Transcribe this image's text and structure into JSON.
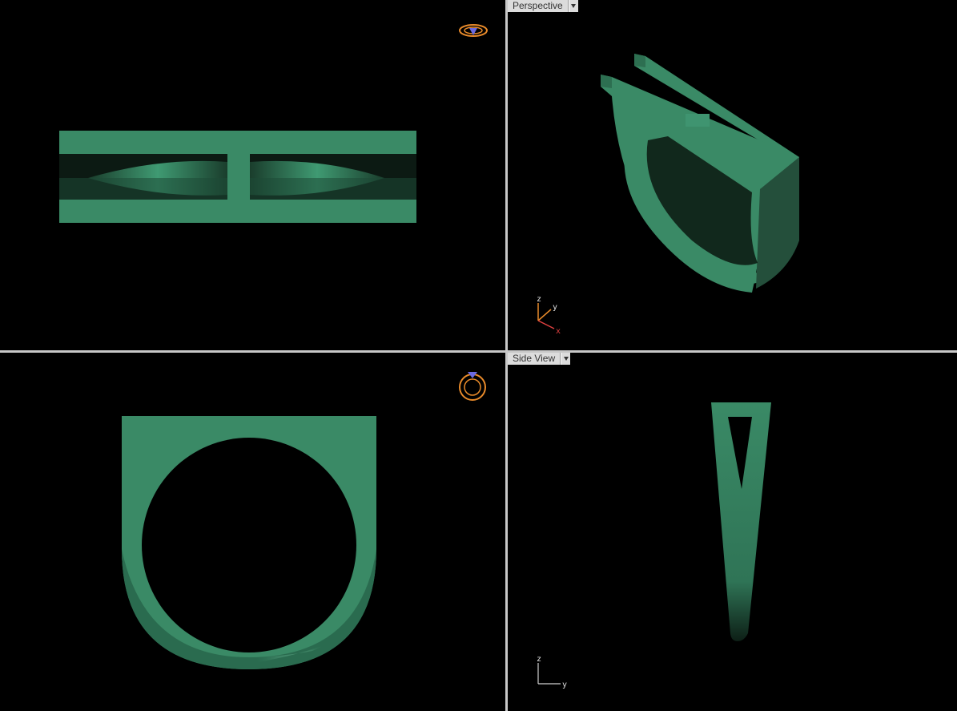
{
  "viewports": {
    "top": {
      "label": ""
    },
    "perspective": {
      "label": "Perspective"
    },
    "front": {
      "label": ""
    },
    "side": {
      "label": "Side View"
    }
  },
  "axes": {
    "perspective": {
      "z": "z",
      "y": "y",
      "x": "x"
    },
    "side": {
      "z": "z",
      "y": "y"
    }
  },
  "colors": {
    "background": "#000000",
    "model": "#3a8a66",
    "model_dark": "#1f4d39",
    "divider": "#c8c8c8",
    "nav_icon": "#e88a2a",
    "gem_icon": "#6a6ae0"
  },
  "icons": {
    "view_cube_top": "ring-top-view-icon",
    "view_cube_front": "ring-front-view-icon"
  }
}
